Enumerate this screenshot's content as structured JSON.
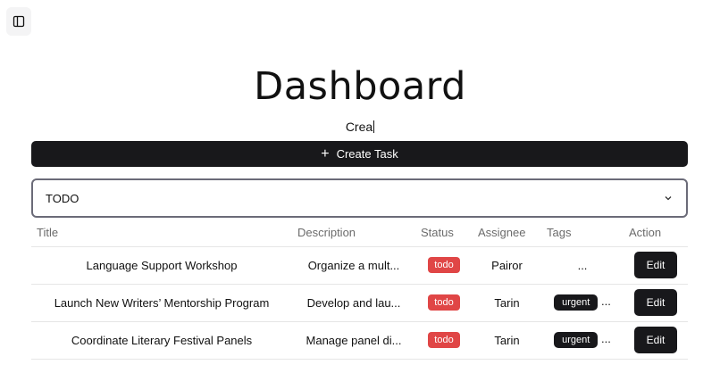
{
  "toolbar": {
    "sidebar_icon": "sidebar-toggle-icon"
  },
  "header": {
    "title": "Dashboard"
  },
  "task_input": {
    "value": "Crea"
  },
  "create_button": {
    "label": "Create Task",
    "icon": "plus-icon"
  },
  "status_filter": {
    "selected": "TODO"
  },
  "table": {
    "columns": [
      "Title",
      "Description",
      "Status",
      "Assignee",
      "Tags",
      "Action"
    ],
    "rows": [
      {
        "title": "Language Support Workshop",
        "description": "Organize a mult...",
        "status": "todo",
        "assignee": "Pairor",
        "tag": "",
        "tags_more": "...",
        "action": "Edit"
      },
      {
        "title": "Launch New Writers’ Mentorship Program",
        "description": "Develop and lau...",
        "status": "todo",
        "assignee": "Tarin",
        "tag": "urgent",
        "tags_more": "...",
        "action": "Edit"
      },
      {
        "title": "Coordinate Literary Festival Panels",
        "description": "Manage panel di...",
        "status": "todo",
        "assignee": "Tarin",
        "tag": "urgent",
        "tags_more": "...",
        "action": "Edit"
      }
    ]
  },
  "colors": {
    "primary": "#18181b",
    "todo_badge": "#e04646",
    "border": "#6b6b78"
  }
}
